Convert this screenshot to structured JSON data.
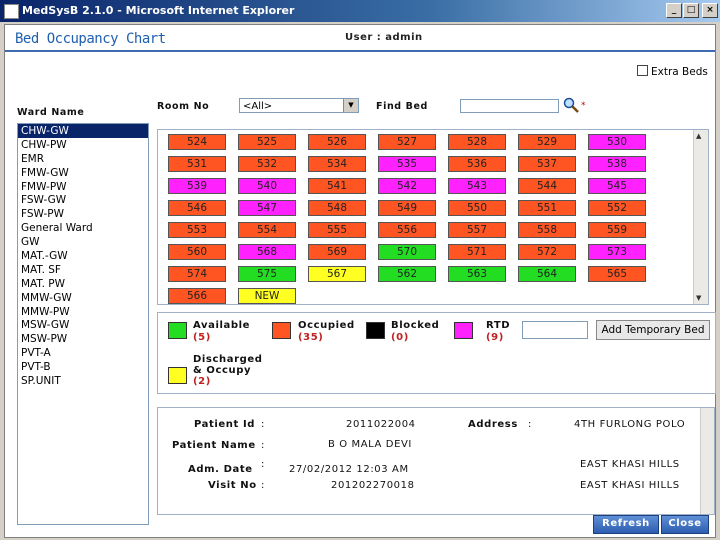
{
  "window": {
    "title": "MedSysB 2.1.0 - Microsoft Internet Explorer",
    "min": "_",
    "max": "□",
    "close": "×"
  },
  "header": {
    "title": "Bed Occupancy Chart",
    "user": "User : admin"
  },
  "extra_beds": {
    "label": "Extra Beds",
    "checked": false
  },
  "ward": {
    "label": "Ward Name",
    "items": [
      "CHW-GW",
      "CHW-PW",
      "EMR",
      "FMW-GW",
      "FMW-PW",
      "FSW-GW",
      "FSW-PW",
      "General Ward",
      "GW",
      "MAT.-GW",
      "MAT. SF",
      "MAT. PW",
      "MMW-GW",
      "MMW-PW",
      "MSW-GW",
      "MSW-PW",
      "PVT-A",
      "PVT-B",
      "SP.UNIT"
    ],
    "selected": "CHW-GW"
  },
  "room": {
    "label": "Room No",
    "value": "<All>"
  },
  "find": {
    "label": "Find Bed",
    "value": "",
    "star": "*"
  },
  "colors": {
    "available": "#22dd22",
    "occupied": "#ff5522",
    "blocked": "#000000",
    "rtd": "#ff22ff",
    "discharged": "#ffff22"
  },
  "beds": [
    [
      {
        "n": "524",
        "s": "occupied"
      },
      {
        "n": "525",
        "s": "occupied"
      },
      {
        "n": "526",
        "s": "occupied"
      },
      {
        "n": "527",
        "s": "occupied"
      },
      {
        "n": "528",
        "s": "occupied"
      },
      {
        "n": "529",
        "s": "occupied"
      },
      {
        "n": "530",
        "s": "rtd"
      }
    ],
    [
      {
        "n": "531",
        "s": "occupied"
      },
      {
        "n": "532",
        "s": "occupied"
      },
      {
        "n": "534",
        "s": "occupied"
      },
      {
        "n": "535",
        "s": "rtd"
      },
      {
        "n": "536",
        "s": "occupied"
      },
      {
        "n": "537",
        "s": "occupied"
      },
      {
        "n": "538",
        "s": "rtd"
      }
    ],
    [
      {
        "n": "539",
        "s": "rtd"
      },
      {
        "n": "540",
        "s": "rtd"
      },
      {
        "n": "541",
        "s": "occupied"
      },
      {
        "n": "542",
        "s": "rtd"
      },
      {
        "n": "543",
        "s": "rtd"
      },
      {
        "n": "544",
        "s": "occupied"
      },
      {
        "n": "545",
        "s": "rtd"
      }
    ],
    [
      {
        "n": "546",
        "s": "occupied"
      },
      {
        "n": "547",
        "s": "rtd"
      },
      {
        "n": "548",
        "s": "occupied"
      },
      {
        "n": "549",
        "s": "occupied"
      },
      {
        "n": "550",
        "s": "occupied"
      },
      {
        "n": "551",
        "s": "occupied"
      },
      {
        "n": "552",
        "s": "occupied"
      }
    ],
    [
      {
        "n": "553",
        "s": "occupied"
      },
      {
        "n": "554",
        "s": "occupied"
      },
      {
        "n": "555",
        "s": "occupied"
      },
      {
        "n": "556",
        "s": "occupied"
      },
      {
        "n": "557",
        "s": "occupied"
      },
      {
        "n": "558",
        "s": "occupied"
      },
      {
        "n": "559",
        "s": "occupied"
      }
    ],
    [
      {
        "n": "560",
        "s": "occupied"
      },
      {
        "n": "568",
        "s": "rtd"
      },
      {
        "n": "569",
        "s": "occupied"
      },
      {
        "n": "570",
        "s": "available"
      },
      {
        "n": "571",
        "s": "occupied"
      },
      {
        "n": "572",
        "s": "occupied"
      },
      {
        "n": "573",
        "s": "rtd"
      }
    ],
    [
      {
        "n": "574",
        "s": "occupied"
      },
      {
        "n": "575",
        "s": "available"
      },
      {
        "n": "567",
        "s": "discharged"
      },
      {
        "n": "562",
        "s": "available"
      },
      {
        "n": "563",
        "s": "available"
      },
      {
        "n": "564",
        "s": "available"
      },
      {
        "n": "565",
        "s": "occupied"
      }
    ],
    [
      {
        "n": "566",
        "s": "occupied"
      },
      {
        "n": "NEW",
        "s": "discharged"
      }
    ]
  ],
  "legend": {
    "available": {
      "label": "Available",
      "count": "(5)"
    },
    "occupied": {
      "label": "Occupied",
      "count": "(35)"
    },
    "blocked": {
      "label": "Blocked",
      "count": "(0)"
    },
    "rtd": {
      "label": "RTD",
      "count": "(9)"
    },
    "discharged": {
      "label1": "Discharged",
      "label2": "& Occupy",
      "count": "(2)"
    },
    "add_temp": "Add Temporary Bed"
  },
  "patient": {
    "id_label": "Patient Id",
    "id": "2011022004",
    "name_label": "Patient Name",
    "name": "B O MALA DEVI",
    "adm_label": "Adm. Date",
    "adm": "27/02/2012 12:03 AM",
    "visit_label": "Visit No",
    "visit": "201202270018",
    "addr_label": "Address",
    "addr1": "4TH FURLONG POLO",
    "addr2": "EAST KHASI HILLS",
    "addr3": "EAST KHASI HILLS",
    "colon": ":"
  },
  "buttons": {
    "refresh": "Refresh",
    "close": "Close"
  }
}
